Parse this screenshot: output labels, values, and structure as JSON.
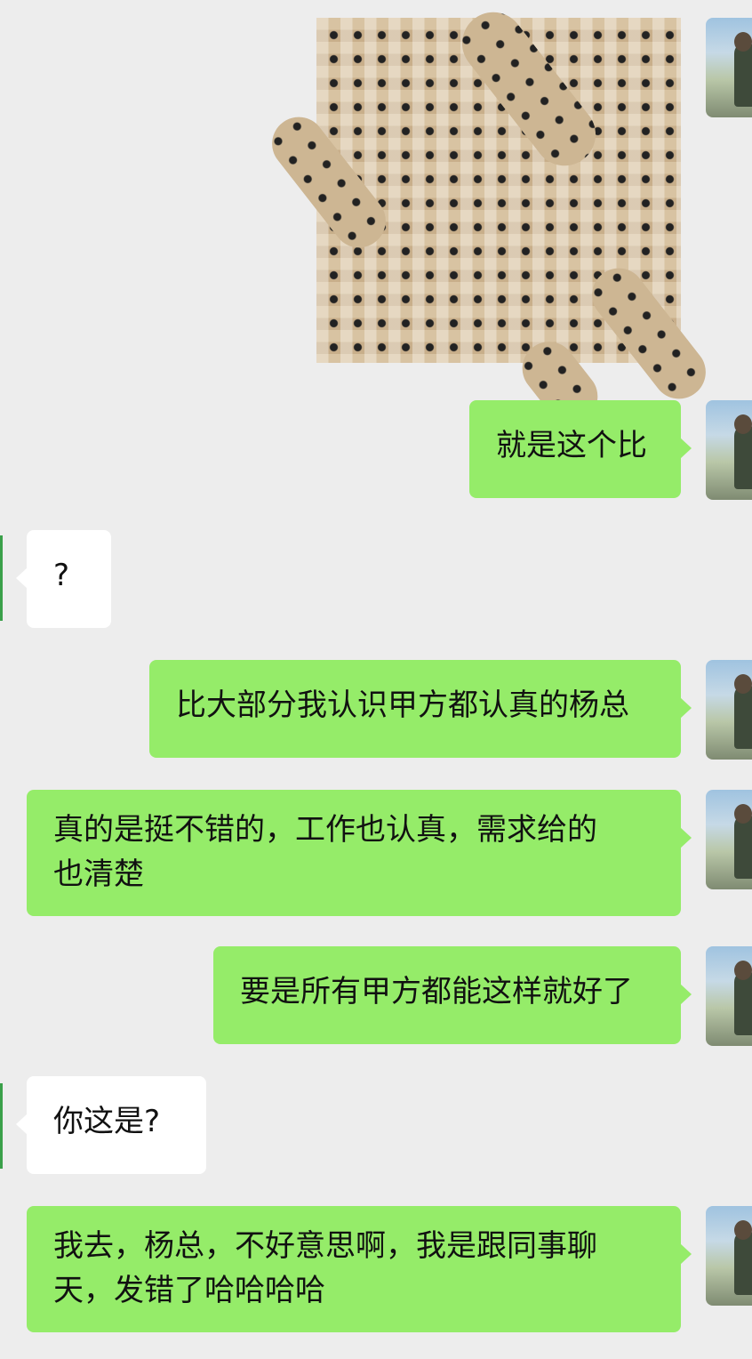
{
  "chat": {
    "image_message": {
      "description": ""
    },
    "messages": [
      {
        "side": "me",
        "text": "就是这个比"
      },
      {
        "side": "other",
        "text": "?"
      },
      {
        "side": "me",
        "text": "比大部分我认识甲方都认真的杨总"
      },
      {
        "side": "me",
        "text_line1": "真的是挺不错的，工作也认真，需求给的",
        "text_line2": "也清楚"
      },
      {
        "side": "me",
        "text": "要是所有甲方都能这样就好了"
      },
      {
        "side": "other",
        "text": "你这是?"
      },
      {
        "side": "me",
        "text_line1": "我去，杨总，不好意思啊，我是跟同事聊",
        "text_line2": "天，发错了哈哈哈哈"
      }
    ]
  },
  "colors": {
    "background": "#ededed",
    "my_bubble": "#95ec69",
    "other_bubble": "#ffffff"
  }
}
